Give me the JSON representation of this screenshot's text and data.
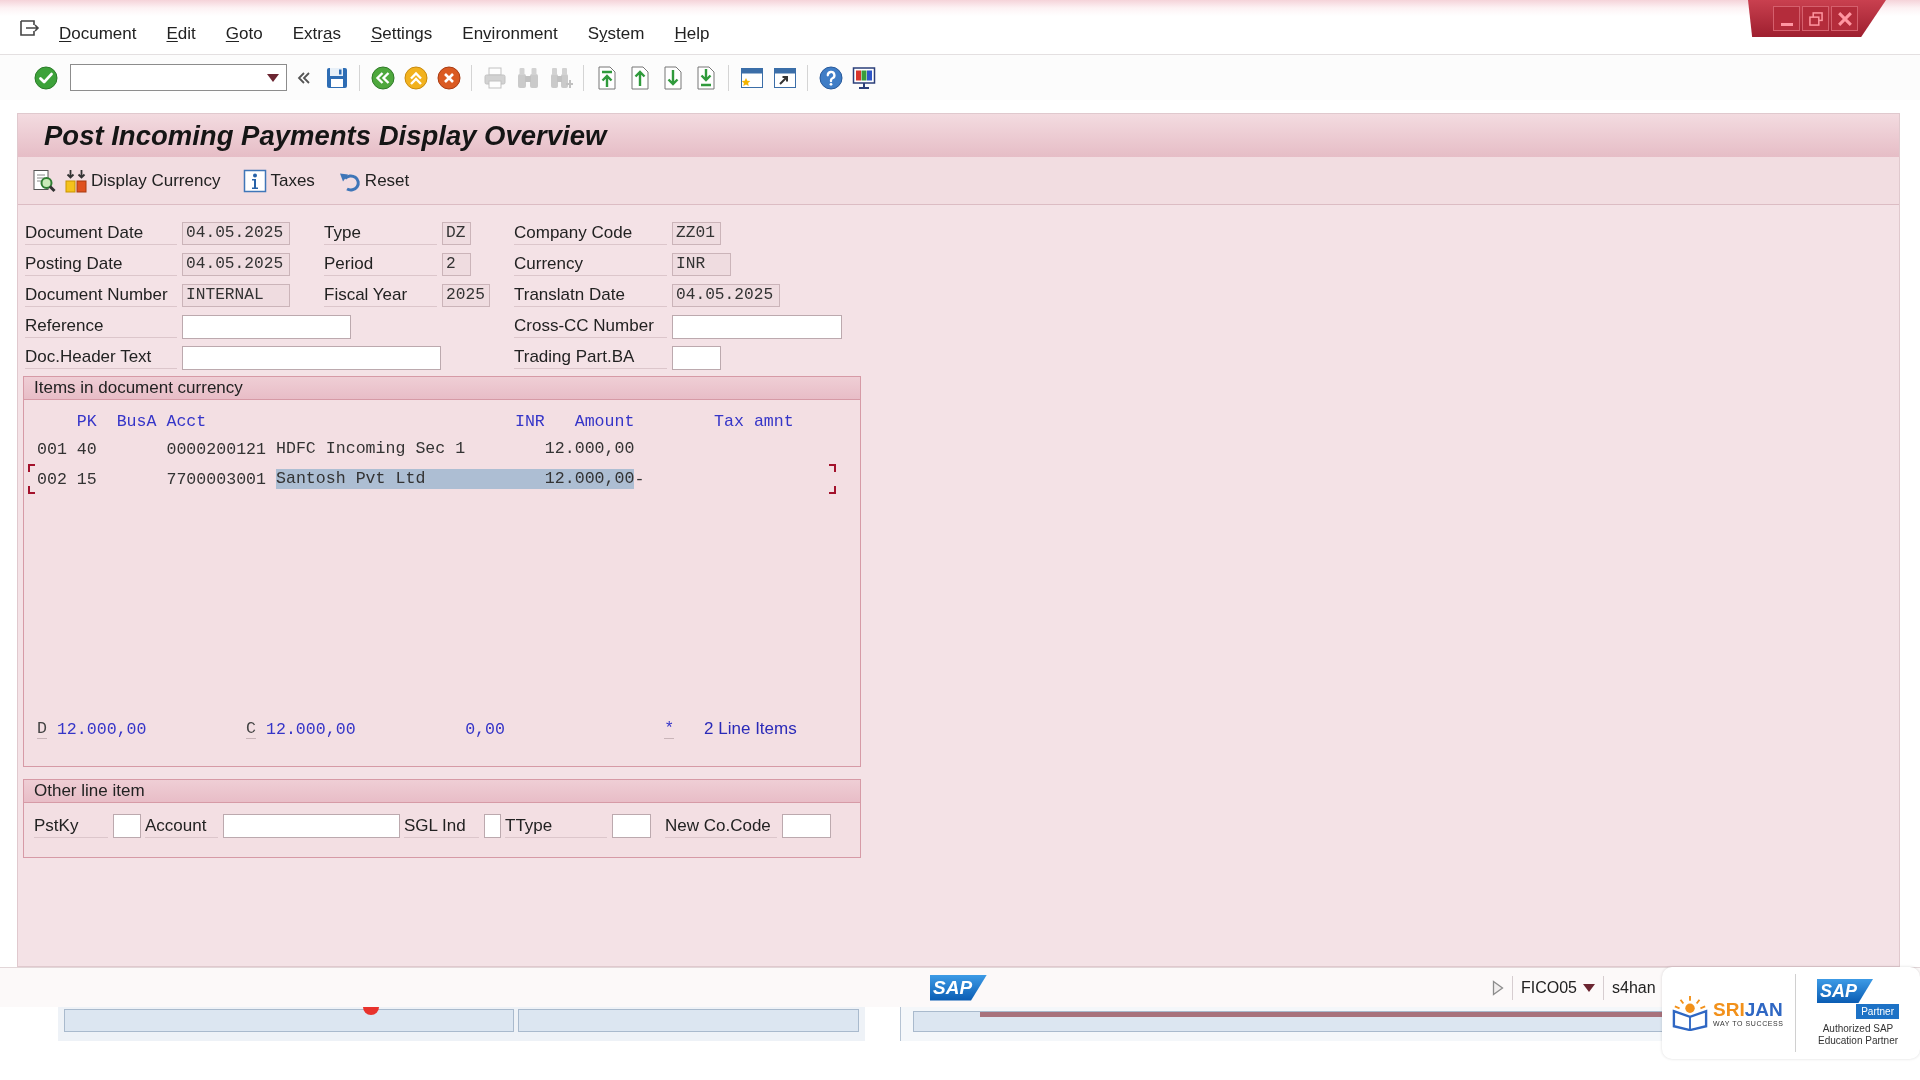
{
  "menu_bar": {
    "items": [
      {
        "key": "D",
        "rest": "ocument"
      },
      {
        "key": "E",
        "rest": "dit"
      },
      {
        "key": "G",
        "rest": "oto"
      },
      {
        "lead": "Extr",
        "key": "a",
        "rest": "s"
      },
      {
        "key": "S",
        "rest": "ettings"
      },
      {
        "lead": "En",
        "key": "v",
        "rest": "ironment"
      },
      {
        "lead": "S",
        "key": "y",
        "rest": "stem"
      },
      {
        "key": "H",
        "rest": "elp"
      }
    ]
  },
  "toolbar": {
    "groups": [
      [
        {
          "kind": "enter",
          "disabled": false
        },
        {
          "kind": "command-field",
          "disabled": false
        },
        {
          "kind": "collapse",
          "disabled": false
        },
        {
          "kind": "save",
          "disabled": false
        }
      ],
      [
        {
          "kind": "back",
          "disabled": false
        },
        {
          "kind": "exit",
          "disabled": false
        },
        {
          "kind": "cancel",
          "disabled": false
        }
      ],
      [
        {
          "kind": "print",
          "disabled": true
        },
        {
          "kind": "find",
          "disabled": true
        },
        {
          "kind": "find-next",
          "disabled": true
        }
      ],
      [
        {
          "kind": "first-page",
          "disabled": false
        },
        {
          "kind": "previous-page",
          "disabled": false
        },
        {
          "kind": "next-page",
          "disabled": false
        },
        {
          "kind": "last-page",
          "disabled": false
        }
      ],
      [
        {
          "kind": "new-session",
          "disabled": false
        },
        {
          "kind": "shortcut",
          "disabled": false
        }
      ],
      [
        {
          "kind": "help",
          "disabled": false
        },
        {
          "kind": "layout",
          "disabled": false
        }
      ]
    ]
  },
  "screen": {
    "title": "Post Incoming Payments Display Overview",
    "actions": [
      {
        "kind": "overview"
      },
      {
        "kind": "currency",
        "label": "Display Currency"
      },
      {
        "kind": "info",
        "label": "Taxes"
      },
      {
        "kind": "undo",
        "label": "Reset"
      }
    ]
  },
  "header_fields": [
    {
      "left": {
        "label": "Document Date",
        "kind": "output",
        "value": "04.05.2025"
      },
      "middle": {
        "label": "Type",
        "kind": "output",
        "value": "DZ"
      },
      "right": {
        "label": "Company Code",
        "kind": "output",
        "value": "ZZ01"
      }
    },
    {
      "left": {
        "label": "Posting Date",
        "kind": "output",
        "value": "04.05.2025"
      },
      "middle": {
        "label": "Period",
        "kind": "output",
        "value": "2"
      },
      "right": {
        "label": "Currency",
        "kind": "output",
        "value": "INR"
      }
    },
    {
      "left": {
        "label": "Document Number",
        "kind": "output",
        "value": "INTERNAL"
      },
      "middle": {
        "label": "Fiscal Year",
        "kind": "output",
        "value": "2025"
      },
      "right": {
        "label": "Translatn Date",
        "kind": "output",
        "value": "04.05.2025"
      }
    },
    {
      "left": {
        "label": "Reference",
        "kind": "input"
      },
      "right": {
        "label": "Cross-CC Number",
        "kind": "input"
      }
    },
    {
      "left": {
        "label": "Doc.Header Text",
        "kind": "input"
      },
      "right": {
        "label": "Trading Part.BA",
        "kind": "input"
      }
    }
  ],
  "items": {
    "title": "Items in document currency",
    "columns": [
      "PK",
      "BusA",
      "Acct",
      "INR",
      "Amount",
      "Tax amnt"
    ],
    "rows": [
      {
        "line": "001",
        "pk": "40",
        "account": "0000200121",
        "text": "HDFC Incoming Sec 1",
        "amount": "12.000,00",
        "selected": false
      },
      {
        "line": "002",
        "pk": "15",
        "account": "7700003001",
        "text": "Santosh Pvt Ltd",
        "amount": "12.000,00",
        "sign": "-",
        "selected": true
      }
    ],
    "totals": {
      "debit_label": "D",
      "debit": "12.000,00",
      "credit_label": "C",
      "credit": "12.000,00",
      "balance": "0,00",
      "status": "*",
      "line_items": "2 Line Items"
    }
  },
  "other_line_item": {
    "title": "Other line item",
    "fields": [
      {
        "label": "PstKy"
      },
      {
        "label": "Account"
      },
      {
        "label": "SGL Ind"
      },
      {
        "label": "TType"
      },
      {
        "label": "New Co.Code"
      }
    ]
  },
  "status_bar": {
    "logo": "SAP",
    "transaction": "FICO05",
    "server": "s4han"
  },
  "partner_badge": {
    "brand": [
      {
        "text": "SRI",
        "color": "#f2911b"
      },
      {
        "text": "JAN",
        "color": "#2f67c3"
      }
    ],
    "tagline": "WAY TO SUCCESS",
    "logo": "SAP",
    "partner_label": "Partner",
    "caption": "Authorized SAP Education Partner"
  }
}
